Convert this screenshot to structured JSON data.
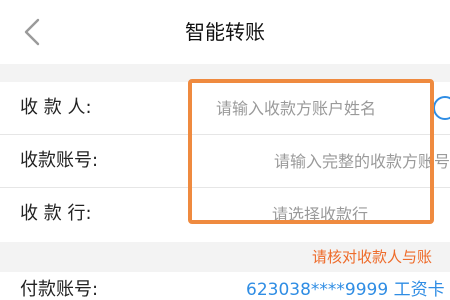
{
  "header": {
    "title": "智能转账"
  },
  "form": {
    "payee": {
      "label": "收 款 人:",
      "placeholder": "请输入收款方账户姓名"
    },
    "account": {
      "label": "收款账号:",
      "placeholder": "请输入完整的收款方账号"
    },
    "bank": {
      "label": "收 款 行:",
      "placeholder": "请选择收款行"
    }
  },
  "notice": {
    "text": "请核对收款人与账"
  },
  "payer": {
    "label": "付款账号:",
    "account_text": "623038****9999  工资卡"
  },
  "colors": {
    "highlight": "#ef8a3f",
    "notice": "#ee6b2a",
    "link": "#2f8de4"
  },
  "icons": {
    "back": "chevron-left-icon",
    "contact": "contact-circle-icon"
  }
}
